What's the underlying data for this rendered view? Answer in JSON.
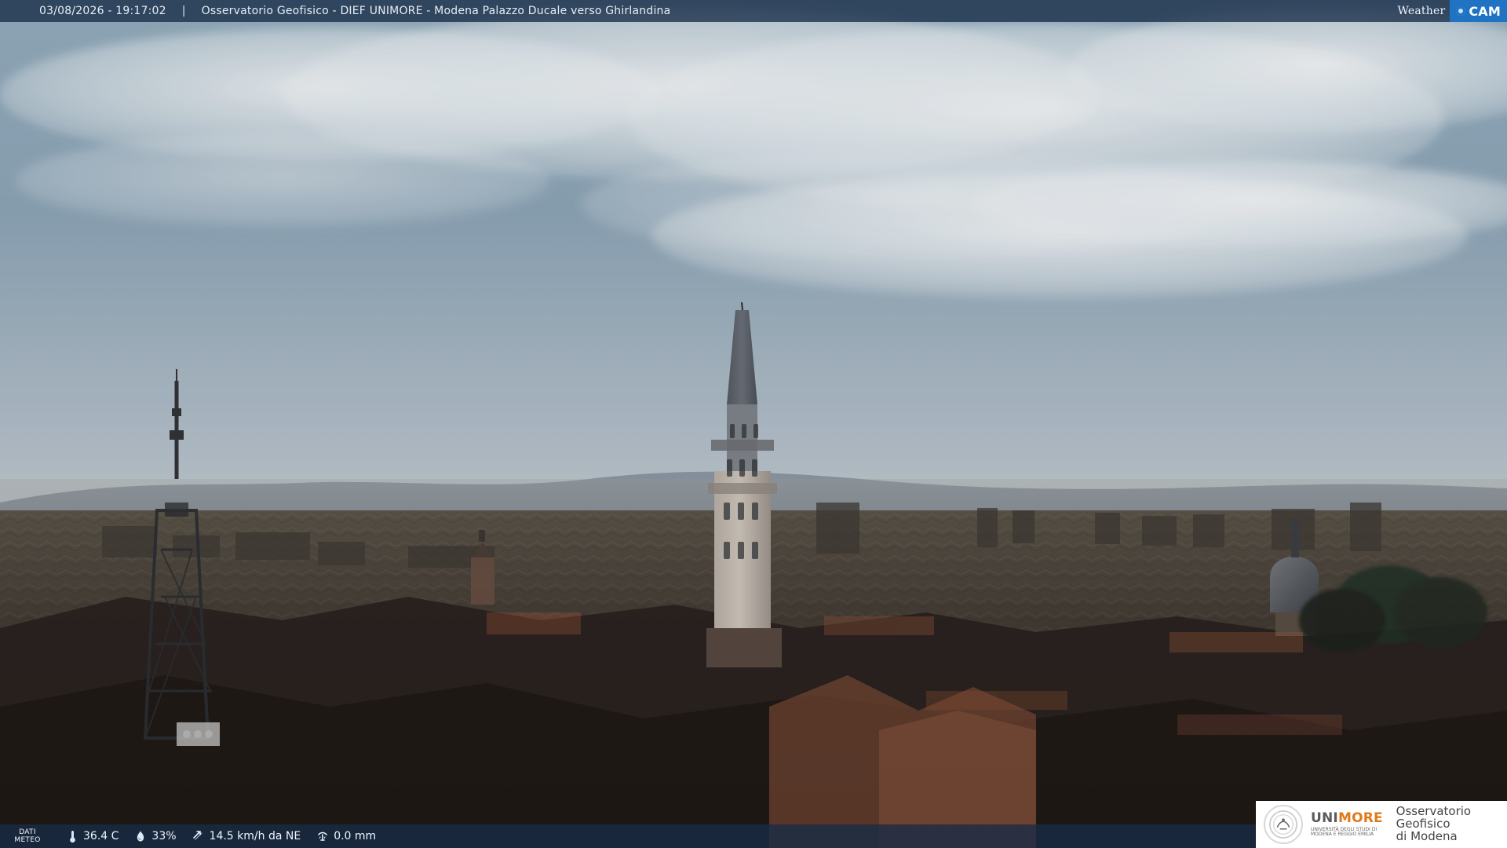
{
  "overlay": {
    "datetime": "03/08/2026 - 19:17:02",
    "separator": "|",
    "title": "Osservatorio Geofisico - DIEF UNIMORE - Modena Palazzo Ducale verso Ghirlandina"
  },
  "weathercam": {
    "weather": "Weather",
    "cam": "CAM"
  },
  "weather_data": {
    "label_line1": "DATI",
    "label_line2": "METEO",
    "temperature": "36.4 C",
    "humidity": "33%",
    "wind": "14.5 km/h da NE",
    "rain": "0.0 mm"
  },
  "logo": {
    "unimore_uni": "UNI",
    "unimore_more": "MORE",
    "unimore_sub": "UNIVERSITÀ DEGLI STUDI DI MODENA E REGGIO EMILIA",
    "obs_line1": "Osservatorio Geofisico",
    "obs_line2": "di Modena"
  },
  "colors": {
    "overlay": "#172C47",
    "accent": "#1f73c2",
    "unimore_orange": "#e07a1a"
  },
  "icons": {
    "temperature": "thermometer-icon",
    "humidity": "humidity-drop-icon",
    "wind": "wind-arrow-icon",
    "rain": "rain-gauge-icon"
  }
}
